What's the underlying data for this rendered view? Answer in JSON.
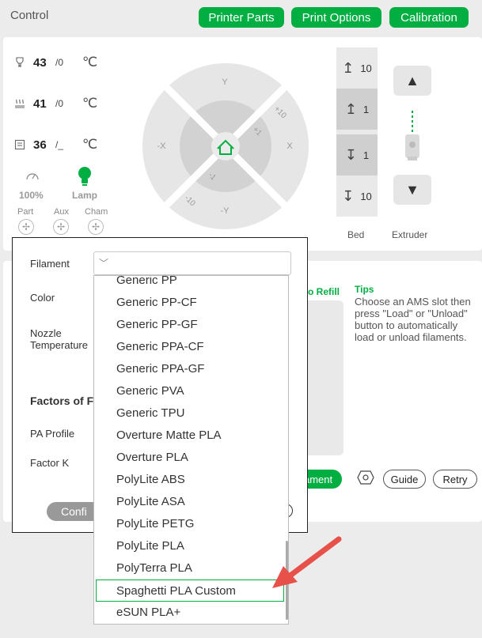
{
  "header": {
    "title": "Control",
    "buttons": [
      "Printer Parts",
      "Print Options",
      "Calibration"
    ]
  },
  "temps": [
    {
      "current": "43",
      "target": "/0",
      "unit": "℃",
      "icon": "nozzle-icon"
    },
    {
      "current": "41",
      "target": "/0",
      "unit": "℃",
      "icon": "heatbed-icon"
    },
    {
      "current": "36",
      "target": "/_",
      "unit": "℃",
      "icon": "chamber-icon"
    }
  ],
  "speed": {
    "value": "100%",
    "icon": "speedometer-icon"
  },
  "lamp": {
    "label": "Lamp",
    "icon": "lightbulb-icon"
  },
  "fans": {
    "part": "Part",
    "aux": "Aux",
    "cham": "Cham"
  },
  "jog": {
    "y": "Y",
    "neg_y": "-Y",
    "x": "X",
    "neg_x": "-X",
    "plus10": "+10",
    "plus1": "+1",
    "minus1": "-1",
    "minus10": "-10",
    "home_icon": "home-icon"
  },
  "bed": {
    "label": "Bed",
    "steps": [
      "10",
      "1",
      "1",
      "10"
    ]
  },
  "extruder": {
    "label": "Extruder"
  },
  "ams": {
    "refill_label": "to Refill",
    "tips_title": "Tips",
    "tips_lines": [
      "Choose an AMS slot then",
      "press \"Load\" or \"Unload\"",
      "button to automatically",
      "load or unload filaments."
    ],
    "load_label": "ament",
    "guide_label": "Guide",
    "retry_label": "Retry"
  },
  "dialog": {
    "filament_label": "Filament",
    "color_label": "Color",
    "nozzle_label_1": "Nozzle",
    "nozzle_label_2": "Temperature",
    "factors_label": "Factors of F",
    "pa_profile_label": "PA Profile",
    "factor_k_label": "Factor K",
    "confirm_label": "Confi",
    "filament_value": ""
  },
  "dropdown": {
    "items": [
      "Generic PP",
      "Generic PP-CF",
      "Generic PP-GF",
      "Generic PPA-CF",
      "Generic PPA-GF",
      "Generic PVA",
      "Generic TPU",
      "Overture Matte PLA",
      "Overture PLA",
      "PolyLite ABS",
      "PolyLite ASA",
      "PolyLite PETG",
      "PolyLite PLA",
      "PolyTerra PLA",
      "Spaghetti PLA Custom",
      "eSUN PLA+"
    ],
    "selected": "Spaghetti PLA Custom"
  },
  "colors": {
    "accent": "#00ae42",
    "annotation_arrow": "#e8514a"
  }
}
